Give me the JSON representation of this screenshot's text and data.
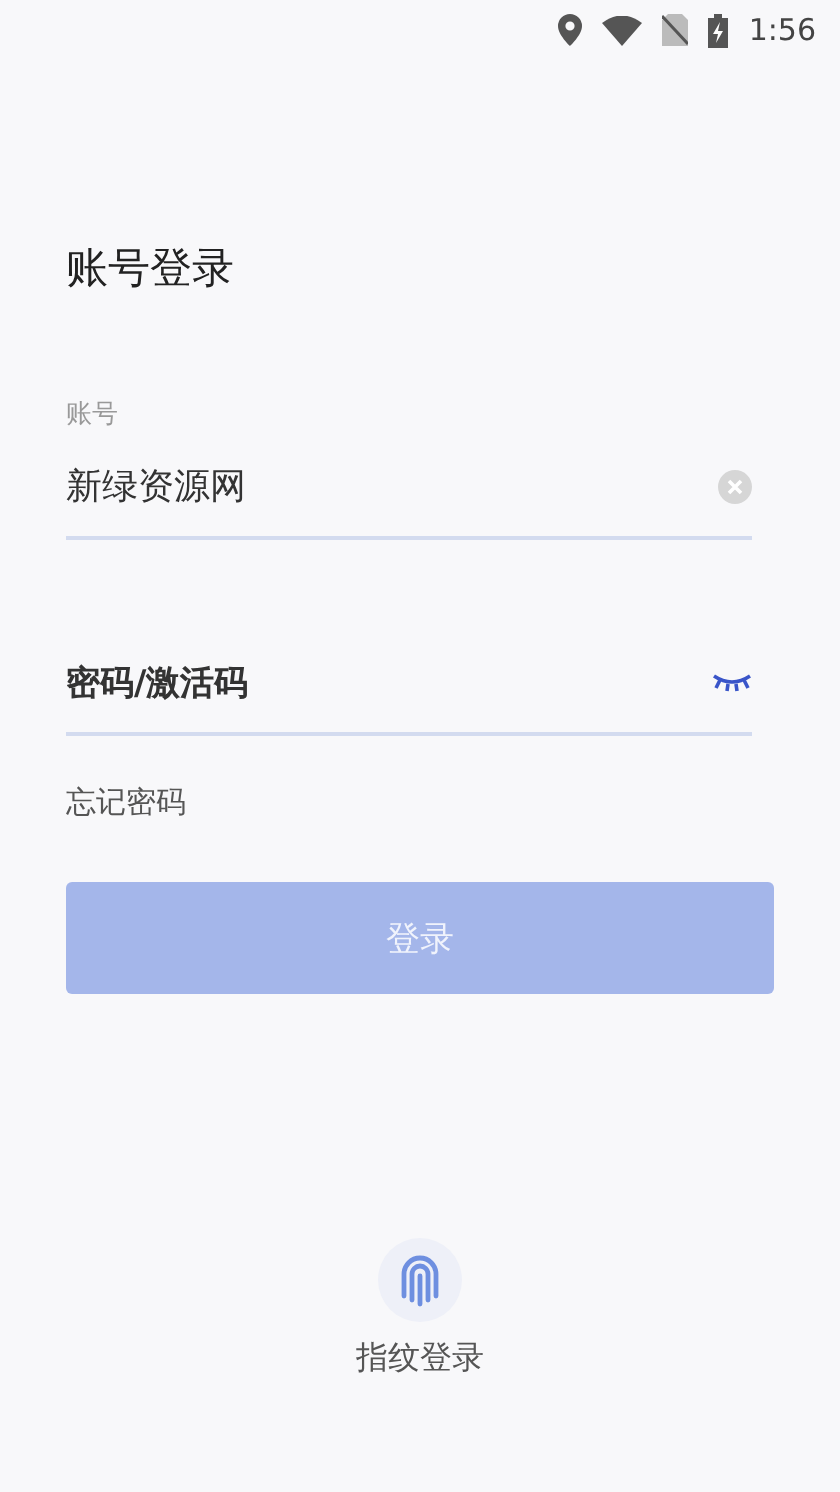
{
  "status_bar": {
    "time": "1:56"
  },
  "title": "账号登录",
  "account": {
    "label": "账号",
    "value": "新绿资源网"
  },
  "password": {
    "placeholder": "密码/激活码",
    "visible": false
  },
  "forgot_link": "忘记密码",
  "login_button": {
    "label": "登录",
    "disabled": true
  },
  "fingerprint_login": "指纹登录"
}
